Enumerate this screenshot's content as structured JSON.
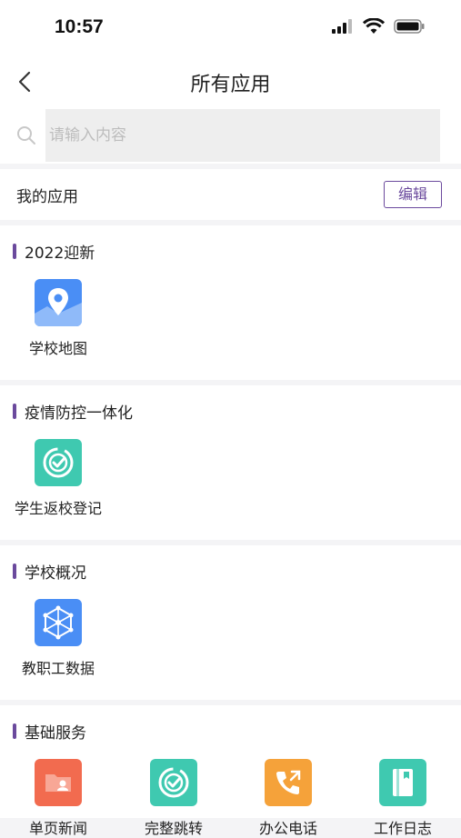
{
  "status": {
    "time": "10:57"
  },
  "nav": {
    "title": "所有应用"
  },
  "search": {
    "placeholder": "请输入内容"
  },
  "my_apps": {
    "label": "我的应用",
    "edit": "编辑"
  },
  "sections": [
    {
      "title": "2022迎新",
      "apps": [
        {
          "name": "学校地图",
          "icon": "map-pin-icon",
          "color": "#4a8ef5"
        }
      ]
    },
    {
      "title": "疫情防控一体化",
      "apps": [
        {
          "name": "学生返校登记",
          "icon": "check-badge-icon",
          "color": "#3fc9b0"
        }
      ]
    },
    {
      "title": "学校概况",
      "apps": [
        {
          "name": "教职工数据",
          "icon": "network-icon",
          "color": "#4a8ef5"
        }
      ]
    },
    {
      "title": "基础服务",
      "apps": [
        {
          "name": "单页新闻",
          "icon": "folder-user-icon",
          "color": "#f26b4f"
        },
        {
          "name": "完整跳转",
          "icon": "check-badge-icon",
          "color": "#3fc9b0"
        },
        {
          "name": "办公电话",
          "icon": "phone-icon",
          "color": "#f5a23a"
        },
        {
          "name": "工作日志",
          "icon": "book-icon",
          "color": "#3fc9b0"
        }
      ]
    }
  ]
}
